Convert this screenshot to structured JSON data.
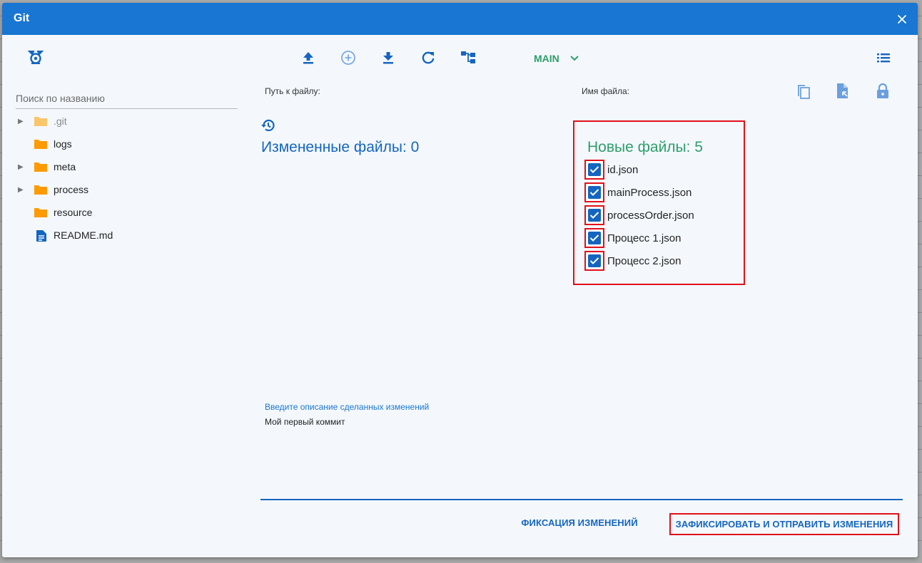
{
  "dialog": {
    "title": "Git",
    "accent_color": "#1976d2"
  },
  "toolbar": {
    "icons": [
      "repo-icon",
      "push-icon",
      "add-circle-icon",
      "pull-icon",
      "refresh-icon",
      "branch-tree-icon",
      "menu-list-icon"
    ],
    "branch_label": "MAIN",
    "branch_color": "#2e9e6b"
  },
  "sidebar": {
    "search_placeholder": "Поиск по названию",
    "items": [
      {
        "label": ".git",
        "expandable": true,
        "icon": "folder-icon"
      },
      {
        "label": "logs",
        "expandable": false,
        "icon": "folder-icon"
      },
      {
        "label": "meta",
        "expandable": true,
        "icon": "folder-icon"
      },
      {
        "label": "process",
        "expandable": true,
        "icon": "folder-icon"
      },
      {
        "label": "resource",
        "expandable": false,
        "icon": "folder-icon"
      },
      {
        "label": "README.md",
        "expandable": false,
        "icon": "file-icon"
      }
    ]
  },
  "main": {
    "path_label": "Путь к файлу:",
    "filename_label": "Имя файла:",
    "actions": [
      "copy-icon",
      "file-open-icon",
      "lock-icon"
    ],
    "changed_title": "Измененные файлы: 0",
    "new_title": "Новые файлы: 5",
    "new_files": [
      {
        "name": "id.json",
        "checked": true
      },
      {
        "name": "mainProcess.json",
        "checked": true
      },
      {
        "name": "processOrder.json",
        "checked": true
      },
      {
        "name": "Процесс 1.json",
        "checked": true
      },
      {
        "name": "Процесс 2.json",
        "checked": true
      }
    ],
    "commit_label": "Введите описание сделанных изменений",
    "commit_message": "Мой первый коммит"
  },
  "footer": {
    "commit_button": "ФИКСАЦИЯ ИЗМЕНЕНИЙ",
    "commit_push_button": "ЗАФИКСИРОВАТЬ И ОТПРАВИТЬ ИЗМЕНЕНИЯ"
  }
}
